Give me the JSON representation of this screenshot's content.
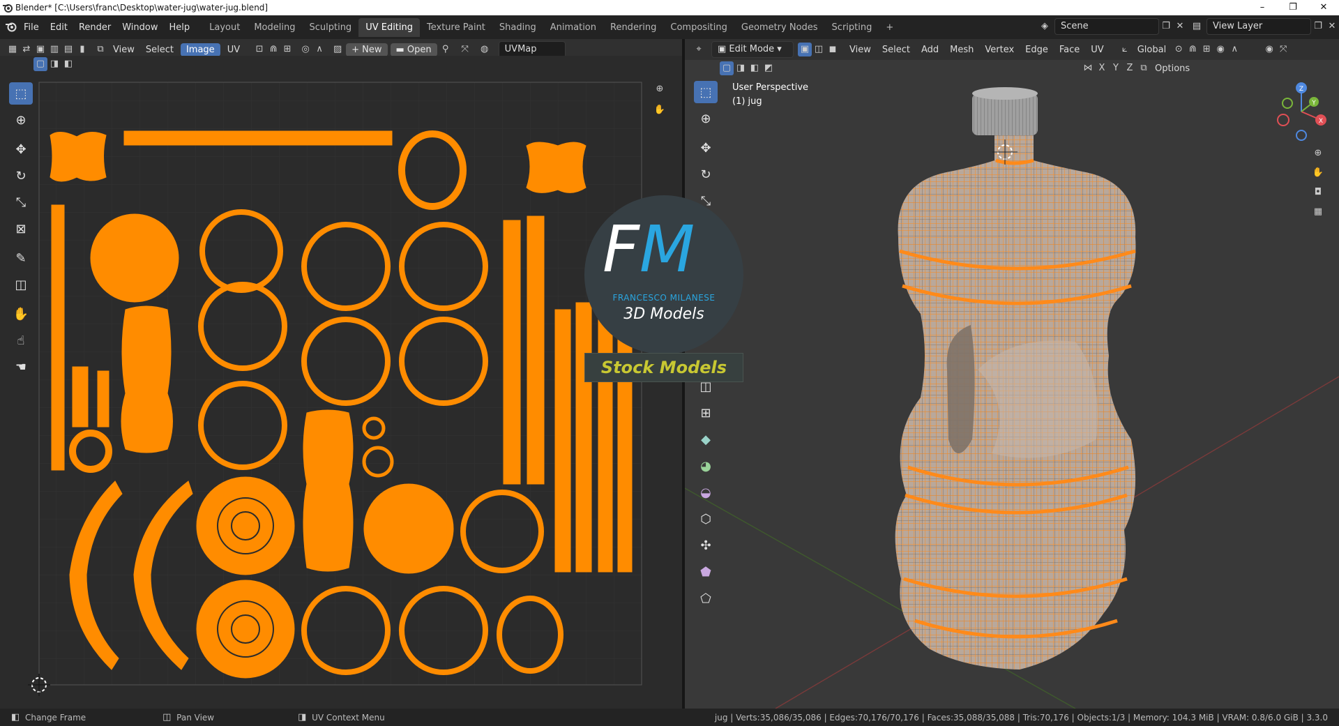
{
  "titlebar": {
    "title": "Blender* [C:\\Users\\franc\\Desktop\\water-jug\\water-jug.blend]",
    "minimize": "–",
    "restore": "❐",
    "close": "✕"
  },
  "menu": [
    "File",
    "Edit",
    "Render",
    "Window",
    "Help"
  ],
  "workspaces": [
    "Layout",
    "Modeling",
    "Sculpting",
    "UV Editing",
    "Texture Paint",
    "Shading",
    "Animation",
    "Rendering",
    "Compositing",
    "Geometry Nodes",
    "Scripting"
  ],
  "active_workspace": "UV Editing",
  "add_workspace": "+",
  "scene": {
    "label": "Scene"
  },
  "view_layer": {
    "label": "View Layer"
  },
  "uv_header": {
    "view": "View",
    "select": "Select",
    "image": "Image",
    "uv": "UV",
    "new": "New",
    "open": "Open",
    "uvmap": "UVMap"
  },
  "vp_header": {
    "mode": "Edit Mode",
    "view": "View",
    "select": "Select",
    "add": "Add",
    "mesh": "Mesh",
    "vertex": "Vertex",
    "edge": "Edge",
    "face": "Face",
    "uv": "UV",
    "orientation": "Global",
    "options": "Options",
    "axes": [
      "X",
      "Y",
      "Z"
    ]
  },
  "viewport": {
    "perspective": "User Perspective",
    "object": "(1) jug"
  },
  "gizmo": {
    "x": "X",
    "y": "Y",
    "z": "Z"
  },
  "watermark": {
    "initials_f": "F",
    "initials_m": "M",
    "name": "FRANCESCO MILANESE",
    "subtitle": "3D Models",
    "banner": "Stock Models"
  },
  "status": {
    "left1": "Change Frame",
    "left2": "Pan View",
    "left3": "UV Context Menu",
    "stats": "jug | Verts:35,086/35,086 | Edges:70,176/70,176 | Faces:35,088/35,088 | Tris:70,176 | Objects:1/3 | Memory: 104.3 MiB | VRAM: 0.8/6.0 GiB | 3.3.0"
  },
  "colors": {
    "accent": "#4772b3",
    "uv_orange": "#ff8c00",
    "mesh_orange": "#ff8a1a",
    "mesh_body": "#b9a89b",
    "cap": "#999999",
    "banner_text": "#c8c832",
    "logo_blue": "#2aa6e0"
  }
}
